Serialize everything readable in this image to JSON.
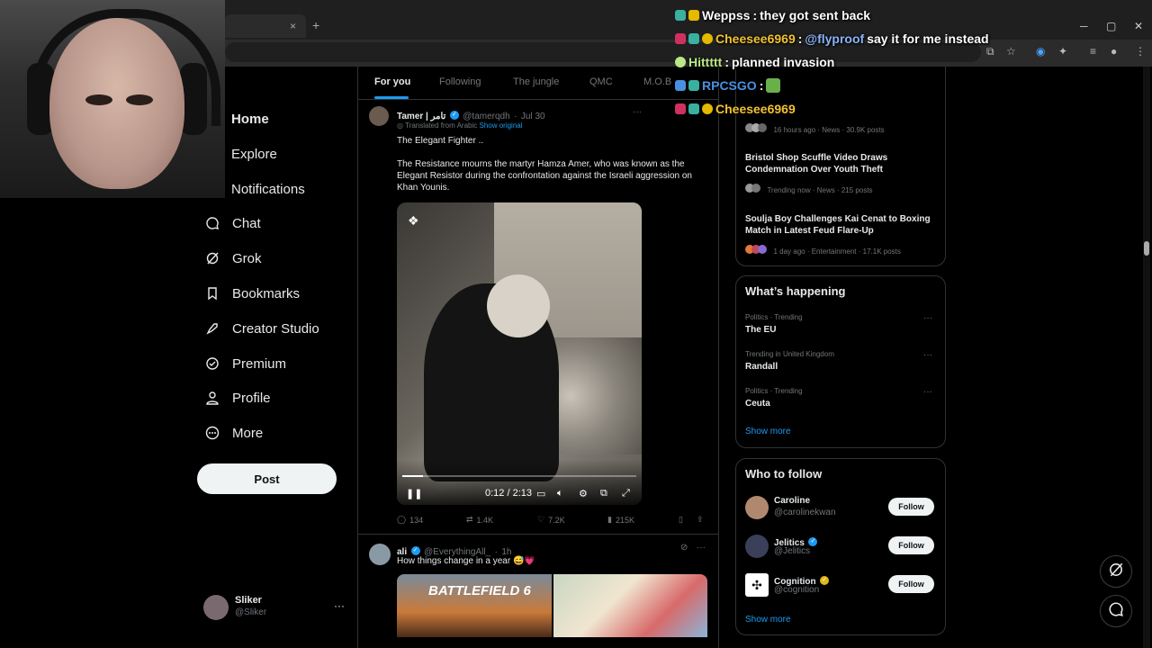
{
  "browser": {
    "tab_close": "×",
    "tab_new": "+",
    "win_min": "─",
    "win_max": "▢",
    "win_close": "✕"
  },
  "nav": {
    "home": "Home",
    "explore": "Explore",
    "notifications": "Notifications",
    "chat": "Chat",
    "grok": "Grok",
    "bookmarks": "Bookmarks",
    "creator_studio": "Creator Studio",
    "premium": "Premium",
    "profile": "Profile",
    "more": "More",
    "post": "Post"
  },
  "account": {
    "name": "Sliker",
    "handle": "@Sliker",
    "more": "···"
  },
  "feed_tabs": [
    "For you",
    "Following",
    "The jungle",
    "QMC",
    "M.O.B"
  ],
  "tweet1": {
    "name": "Tamer | تامر",
    "handle": "@tamerqdh",
    "time": "Jul 30",
    "translated": "Translated from Arabic",
    "show_original": "Show original",
    "line1": "The Elegant Fighter ..",
    "body": "The Resistance mourns the martyr Hamza Amer, who was known as the Elegant Resistor during the confrontation against the Israeli aggression on Khan Younis.",
    "video_time": "0:12 / 2:13",
    "video_progress": 0.09,
    "replies": "134",
    "reposts": "1.4K",
    "likes": "7.2K",
    "views": "215K"
  },
  "tweet2": {
    "name": "ali",
    "handle": "@EverythingAll_",
    "time": "1h",
    "text": "How things change in a year 😅💗",
    "media_label": "BATTLEFIELD 6"
  },
  "trending_top": [
    {
      "meta": "16 hours ago · News · 30.9K posts"
    },
    {
      "title": "Bristol Shop Scuffle Video Draws Condemnation Over Youth Theft",
      "meta": "Trending now · News · 215 posts"
    },
    {
      "title": "Soulja Boy Challenges Kai Cenat to Boxing Match in Latest Feud Flare-Up",
      "meta": "1 day ago · Entertainment · 17.1K posts"
    }
  ],
  "whats_happening": {
    "title": "What’s happening",
    "items": [
      {
        "context": "Politics · Trending",
        "name": "The EU"
      },
      {
        "context": "Trending in United Kingdom",
        "name": "Randall"
      },
      {
        "context": "Politics · Trending",
        "name": "Ceuta"
      }
    ],
    "show_more": "Show more"
  },
  "who_to_follow": {
    "title": "Who to follow",
    "users": [
      {
        "name": "Caroline",
        "handle": "@carolinekwan",
        "button": "Follow"
      },
      {
        "name": "Jelitics",
        "handle": "@Jelitics",
        "button": "Follow"
      },
      {
        "name": "Cognition",
        "handle": "@cognition",
        "button": "Follow"
      }
    ],
    "show_more": "Show more"
  },
  "chat": [
    {
      "user": "Weppss",
      "sep": " : ",
      "msg": "they got sent back",
      "color": "#ffffff"
    },
    {
      "user": "Cheesee6969",
      "sep": " : ",
      "mention": "@flyproof",
      "msg": " say it for me instead",
      "color": "#f2c230"
    },
    {
      "user": "Hittttt",
      "sep": " : ",
      "msg": "planned invasion",
      "color": "#b8e986"
    },
    {
      "user": "RPCSGO",
      "sep": " : ",
      "msg": "",
      "color": "#4a90e2"
    },
    {
      "user": "Cheesee6969",
      "sep": " ",
      "msg": "",
      "color": "#f2c230"
    }
  ],
  "colors": {
    "accent": "#1d9bf0",
    "bg": "#000000",
    "border": "#2f3336",
    "muted": "#71767b"
  }
}
